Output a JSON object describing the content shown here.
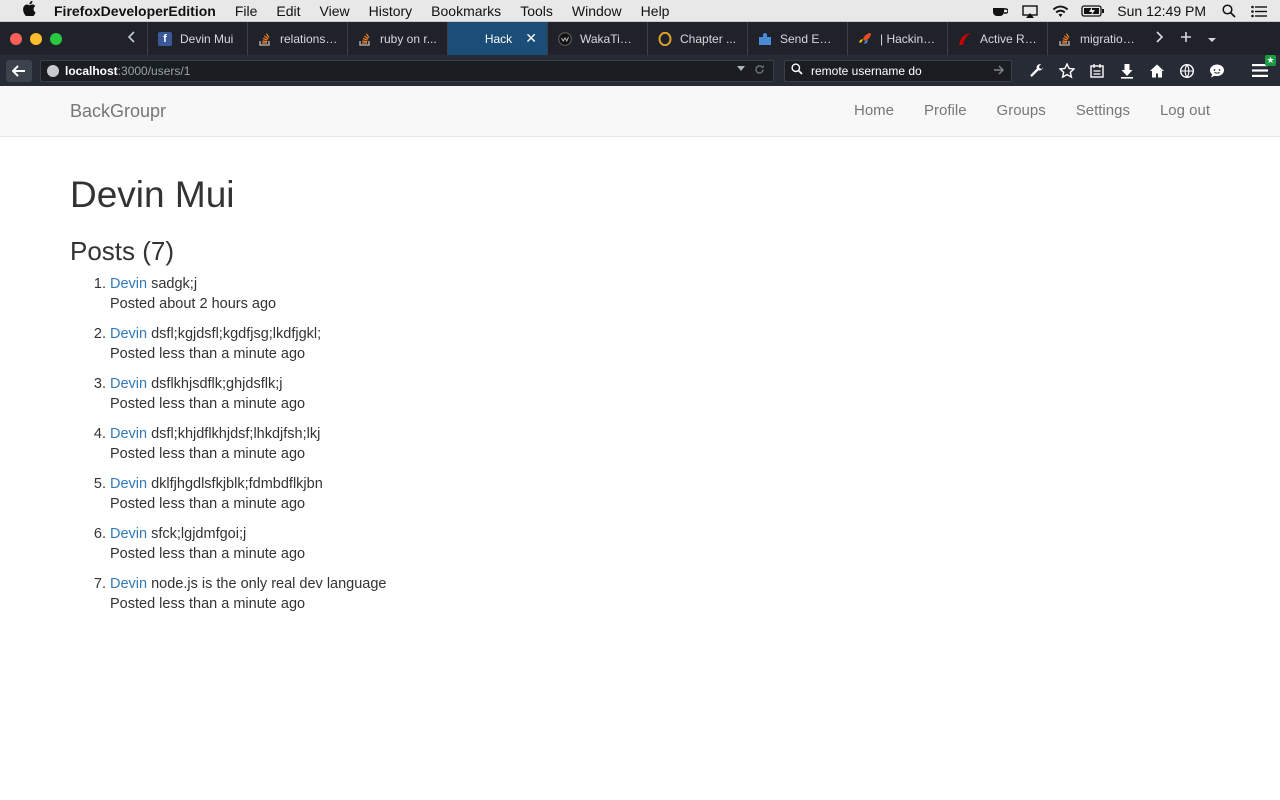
{
  "menubar": {
    "app_name": "FirefoxDeveloperEdition",
    "items": [
      "File",
      "Edit",
      "View",
      "History",
      "Bookmarks",
      "Tools",
      "Window",
      "Help"
    ],
    "clock": "Sun 12:49 PM"
  },
  "tabs": [
    {
      "label": "Devin Mui",
      "icon": "facebook-icon",
      "color": "#3b5998"
    },
    {
      "label": "relationsh...",
      "icon": "stackoverflow-icon",
      "color": "#f48024"
    },
    {
      "label": "ruby on r...",
      "icon": "stackoverflow-icon",
      "color": "#f48024"
    },
    {
      "label": "Hack",
      "icon": "",
      "color": "",
      "active": true
    },
    {
      "label": "WakaTim...",
      "icon": "wakatime-icon",
      "color": "#2b2b2b"
    },
    {
      "label": "Chapter ...",
      "icon": "opera-icon",
      "color": "#e0a030"
    },
    {
      "label": "Send Em...",
      "icon": "puzzle-icon",
      "color": "#4a8ad4"
    },
    {
      "label": "| Hacking...",
      "icon": "rocket-icon",
      "color": "#e44d26"
    },
    {
      "label": "Active Re...",
      "icon": "rails-icon",
      "color": "#cc0000"
    },
    {
      "label": "migration...",
      "icon": "stackoverflow-icon",
      "color": "#f48024"
    }
  ],
  "urlbar": {
    "host": "localhost",
    "path": ":3000/users/1"
  },
  "searchbar": {
    "value": "remote username do"
  },
  "site": {
    "brand": "BackGroupr",
    "nav": [
      "Home",
      "Profile",
      "Groups",
      "Settings",
      "Log out"
    ]
  },
  "profile": {
    "name": "Devin Mui",
    "posts_heading": "Posts (7)"
  },
  "posts": [
    {
      "author": "Devin",
      "content": "sadgk;j",
      "time": "Posted about 2 hours ago"
    },
    {
      "author": "Devin",
      "content": "dsfl;kgjdsfl;kgdfjsg;lkdfjgkl;",
      "time": "Posted less than a minute ago"
    },
    {
      "author": "Devin",
      "content": "dsflkhjsdflk;ghjdsflk;j",
      "time": "Posted less than a minute ago"
    },
    {
      "author": "Devin",
      "content": "dsfl;khjdflkhjdsf;lhkdjfsh;lkj",
      "time": "Posted less than a minute ago"
    },
    {
      "author": "Devin",
      "content": "dklfjhgdlsfkjblk;fdmbdflkjbn",
      "time": "Posted less than a minute ago"
    },
    {
      "author": "Devin",
      "content": "sfck;lgjdmfgoi;j",
      "time": "Posted less than a minute ago"
    },
    {
      "author": "Devin",
      "content": "node.js is the only real dev language",
      "time": "Posted less than a minute ago"
    }
  ],
  "colors": {
    "link": "#337ab7",
    "active_tab": "#1a4d78",
    "tabstrip": "#1f2329",
    "toolbar": "#272b35"
  }
}
